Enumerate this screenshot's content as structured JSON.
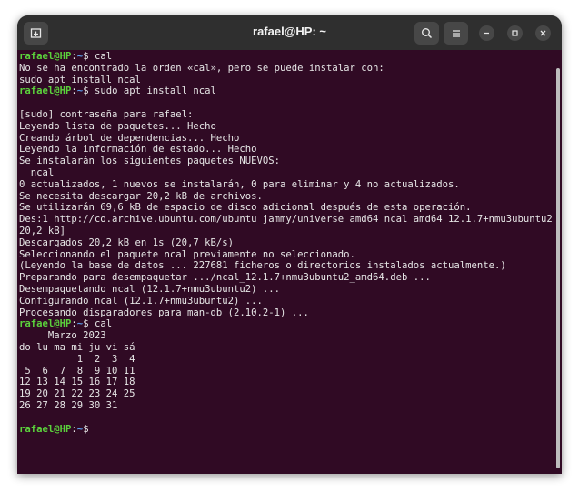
{
  "window": {
    "title": "rafael@HP: ~"
  },
  "titlebar": {
    "new_tab_icon": "new-tab-icon",
    "search_icon": "search-icon",
    "menu_icon": "hamburger-menu-icon",
    "minimize_icon": "minimize-icon",
    "maximize_icon": "maximize-icon",
    "close_icon": "close-icon"
  },
  "colors": {
    "terminal_bg": "#300a24",
    "prompt_user": "#5bd13c",
    "prompt_path": "#5c9ded",
    "text": "#e6e6e6"
  },
  "terminal": {
    "prompt": {
      "user": "rafael@HP",
      "sep": ":",
      "path": "~",
      "symbol": "$"
    },
    "lines": [
      {
        "prompt": true,
        "cmd": " cal"
      },
      {
        "text": "No se ha encontrado la orden «cal», pero se puede instalar con:"
      },
      {
        "text": "sudo apt install ncal"
      },
      {
        "prompt": true,
        "cmd": " sudo apt install ncal"
      },
      {
        "text": ""
      },
      {
        "text": "[sudo] contraseña para rafael:"
      },
      {
        "text": "Leyendo lista de paquetes... Hecho"
      },
      {
        "text": "Creando árbol de dependencias... Hecho"
      },
      {
        "text": "Leyendo la información de estado... Hecho"
      },
      {
        "text": "Se instalarán los siguientes paquetes NUEVOS:"
      },
      {
        "text": "  ncal"
      },
      {
        "text": "0 actualizados, 1 nuevos se instalarán, 0 para eliminar y 4 no actualizados."
      },
      {
        "text": "Se necesita descargar 20,2 kB de archivos."
      },
      {
        "text": "Se utilizarán 69,6 kB de espacio de disco adicional después de esta operación."
      },
      {
        "text": "Des:1 http://co.archive.ubuntu.com/ubuntu jammy/universe amd64 ncal amd64 12.1.7+nmu3ubuntu2 ["
      },
      {
        "text": "20,2 kB]"
      },
      {
        "text": "Descargados 20,2 kB en 1s (20,7 kB/s)"
      },
      {
        "text": "Seleccionando el paquete ncal previamente no seleccionado."
      },
      {
        "text": "(Leyendo la base de datos ... 227681 ficheros o directorios instalados actualmente.)"
      },
      {
        "text": "Preparando para desempaquetar .../ncal_12.1.7+nmu3ubuntu2_amd64.deb ..."
      },
      {
        "text": "Desempaquetando ncal (12.1.7+nmu3ubuntu2) ..."
      },
      {
        "text": "Configurando ncal (12.1.7+nmu3ubuntu2) ..."
      },
      {
        "text": "Procesando disparadores para man-db (2.10.2-1) ..."
      },
      {
        "prompt": true,
        "cmd": " cal"
      },
      {
        "text": "     Marzo 2023"
      },
      {
        "text": "do lu ma mi ju vi sá"
      },
      {
        "text": "          1  2  3  4"
      },
      {
        "text": " 5  6  7  8  9 10 11"
      },
      {
        "text": "12 13 14 15 16 17 18"
      },
      {
        "text": "19 20 21 22 23 24 25"
      },
      {
        "text": "26 27 28 29 30 31"
      },
      {
        "text": ""
      },
      {
        "prompt": true,
        "cmd": " ",
        "cursor": true
      }
    ]
  }
}
